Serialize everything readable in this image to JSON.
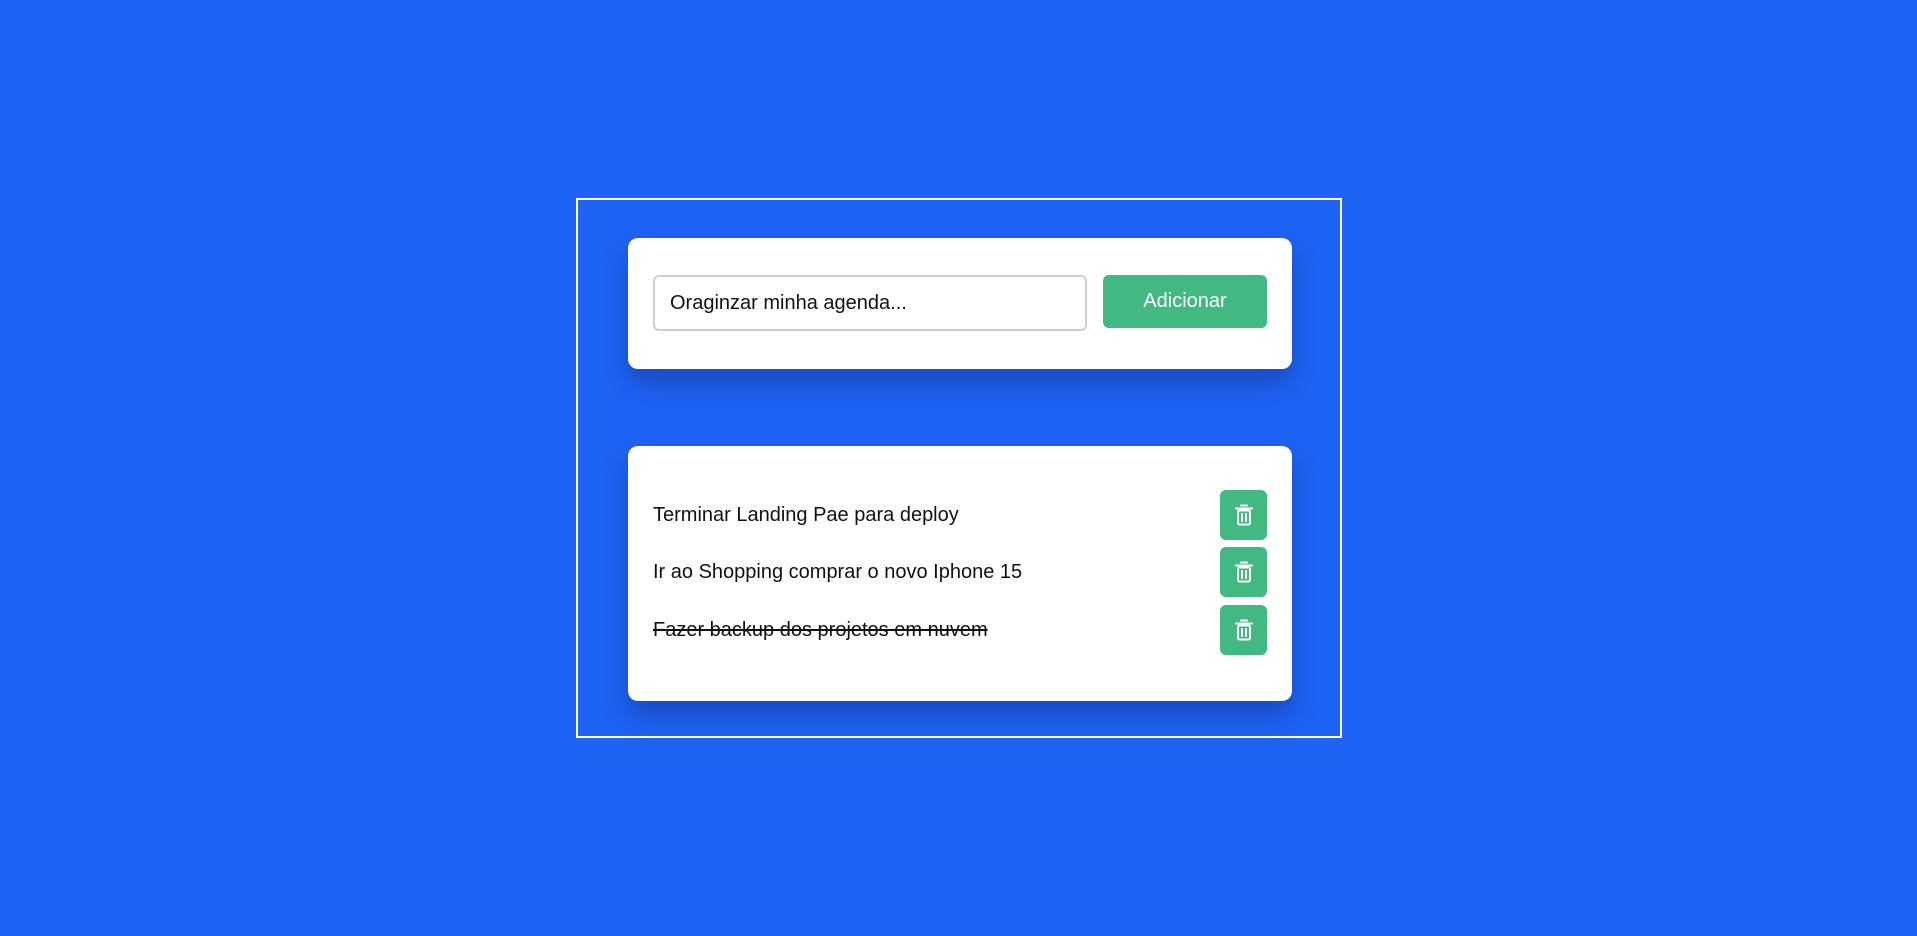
{
  "new_task": {
    "value": "Oraginzar minha agenda...",
    "add_label": "Adicionar"
  },
  "tasks": [
    {
      "text": "Terminar Landing Pae para deploy",
      "done": false,
      "delete_icon": "trash-icon"
    },
    {
      "text": "Ir ao Shopping comprar o novo Iphone 15",
      "done": false,
      "delete_icon": "trash-icon"
    },
    {
      "text": "Fazer backup dos projetos em nuvem",
      "done": true,
      "delete_icon": "trash-icon"
    }
  ],
  "colors": {
    "background": "#1f63f4",
    "accent": "#42b883",
    "card": "#ffffff"
  }
}
